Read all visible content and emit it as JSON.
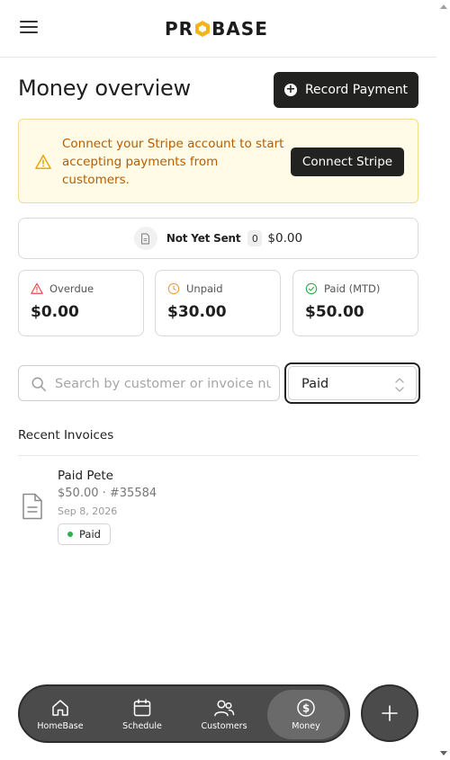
{
  "header": {
    "logo_text": "PROBASE",
    "logo_prefix": "PR",
    "logo_suffix": "BASE"
  },
  "title": "Money overview",
  "record_payment_label": "Record Payment",
  "stripe": {
    "message": "Connect your Stripe account to start accepting payments from customers.",
    "button_label": "Connect Stripe",
    "text_color": "#b85c00",
    "bg_color": "#fffbe6"
  },
  "not_yet_sent": {
    "label": "Not Yet Sent",
    "count": "0",
    "amount": "$0.00"
  },
  "stats": [
    {
      "label": "Overdue",
      "value": "$0.00",
      "icon": "alert-triangle-icon",
      "color": "#e5484d"
    },
    {
      "label": "Unpaid",
      "value": "$30.00",
      "icon": "clock-icon",
      "color": "#e8a33d"
    },
    {
      "label": "Paid (MTD)",
      "value": "$50.00",
      "icon": "check-circle-icon",
      "color": "#2bb24c"
    }
  ],
  "search": {
    "placeholder": "Search by customer or invoice number",
    "value": ""
  },
  "status_filter": {
    "selected": "Paid"
  },
  "recent_invoices": {
    "title": "Recent Invoices",
    "items": [
      {
        "customer": "Paid Pete",
        "meta": "$50.00 · #35584",
        "date": "Sep 8, 2026",
        "status": "Paid"
      }
    ]
  },
  "nav": {
    "items": [
      {
        "label": "HomeBase",
        "icon": "home-icon",
        "active": false
      },
      {
        "label": "Schedule",
        "icon": "calendar-icon",
        "active": false
      },
      {
        "label": "Customers",
        "icon": "users-icon",
        "active": false
      },
      {
        "label": "Money",
        "icon": "dollar-circle-icon",
        "active": true
      }
    ],
    "fab_icon": "plus-icon"
  }
}
